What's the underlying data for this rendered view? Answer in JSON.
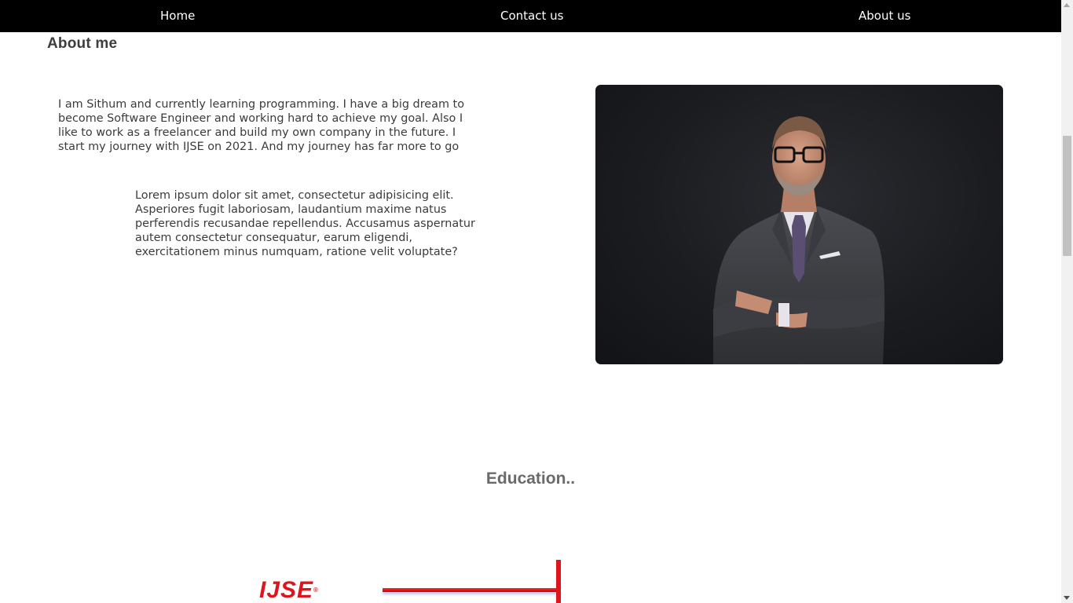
{
  "nav": {
    "items": [
      {
        "label": "Home"
      },
      {
        "label": "Contact us"
      },
      {
        "label": "About us"
      }
    ]
  },
  "about": {
    "title": "About me",
    "intro": "I am Sithum and currently learning programming. I have a big dream to become Software Engineer and working hard to achieve my goal. Also I like to work as a freelancer and build my own company in the future. I start my journey with IJSE on 2021. And my journey has far more to go",
    "lorem": "Lorem ipsum dolor sit amet, consectetur adipisicing elit. Asperiores fugit laboriosam, laudantium maxime natus perferendis recusandae repellendus. Accusamus aspernatur autem consectetur consequatur, earum eligendi, exercitationem minus numquam, ratione velit voluptate?"
  },
  "education": {
    "title": "Education..",
    "logo_text": "IJSE",
    "logo_mark": "®"
  },
  "colors": {
    "navbar_bg": "#000000",
    "nav_text": "#ffffff",
    "accent_red": "#e0141c",
    "heading": "#3d3d3d",
    "education_heading": "#6a6a6a"
  }
}
